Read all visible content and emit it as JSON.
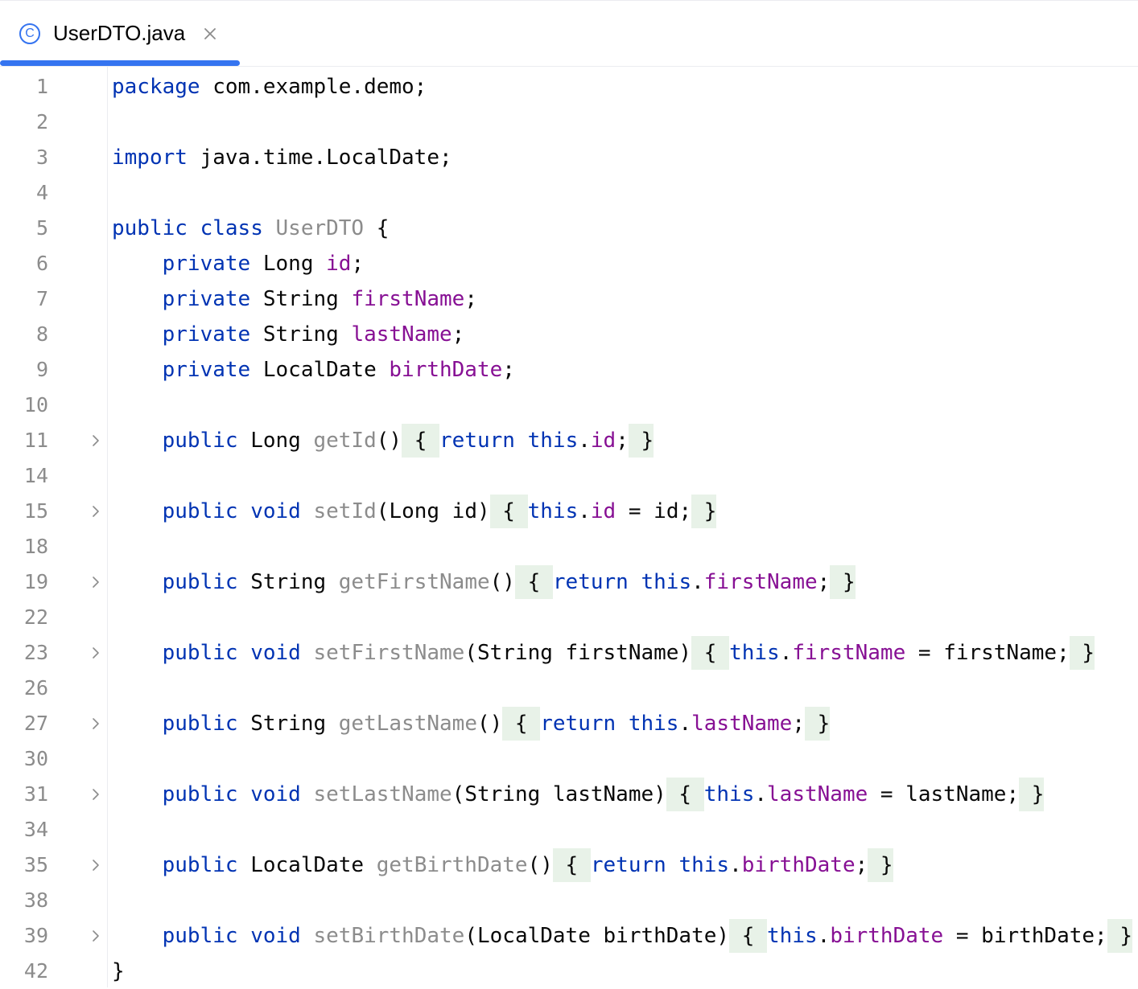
{
  "tab": {
    "icon": "class-icon",
    "icon_glyph": "C",
    "title": "UserDTO.java",
    "close_icon": "close-icon"
  },
  "colors": {
    "accent": "#3574f0",
    "keyword": "#0033b3",
    "field": "#871094",
    "line_number": "#8c8c8c",
    "text": "#080808",
    "fold_highlight": "#e8f2e8"
  },
  "lines": [
    {
      "num": "1",
      "fold": false,
      "tokens": [
        {
          "t": "package",
          "c": "kw"
        },
        {
          "t": " com.example.demo;",
          "c": ""
        }
      ]
    },
    {
      "num": "2",
      "fold": false,
      "tokens": []
    },
    {
      "num": "3",
      "fold": false,
      "tokens": [
        {
          "t": "import",
          "c": "kw"
        },
        {
          "t": " java.time.LocalDate;",
          "c": ""
        }
      ]
    },
    {
      "num": "4",
      "fold": false,
      "tokens": []
    },
    {
      "num": "5",
      "fold": false,
      "tokens": [
        {
          "t": "public",
          "c": "kw"
        },
        {
          "t": " ",
          "c": ""
        },
        {
          "t": "class",
          "c": "kw"
        },
        {
          "t": " ",
          "c": ""
        },
        {
          "t": "UserDTO",
          "c": "dim"
        },
        {
          "t": " {",
          "c": ""
        }
      ]
    },
    {
      "num": "6",
      "fold": false,
      "tokens": [
        {
          "t": "    ",
          "c": ""
        },
        {
          "t": "private",
          "c": "kw"
        },
        {
          "t": " Long ",
          "c": ""
        },
        {
          "t": "id",
          "c": "fld"
        },
        {
          "t": ";",
          "c": ""
        }
      ]
    },
    {
      "num": "7",
      "fold": false,
      "tokens": [
        {
          "t": "    ",
          "c": ""
        },
        {
          "t": "private",
          "c": "kw"
        },
        {
          "t": " String ",
          "c": ""
        },
        {
          "t": "firstName",
          "c": "fld"
        },
        {
          "t": ";",
          "c": ""
        }
      ]
    },
    {
      "num": "8",
      "fold": false,
      "tokens": [
        {
          "t": "    ",
          "c": ""
        },
        {
          "t": "private",
          "c": "kw"
        },
        {
          "t": " String ",
          "c": ""
        },
        {
          "t": "lastName",
          "c": "fld"
        },
        {
          "t": ";",
          "c": ""
        }
      ]
    },
    {
      "num": "9",
      "fold": false,
      "tokens": [
        {
          "t": "    ",
          "c": ""
        },
        {
          "t": "private",
          "c": "kw"
        },
        {
          "t": " LocalDate ",
          "c": ""
        },
        {
          "t": "birthDate",
          "c": "fld"
        },
        {
          "t": ";",
          "c": ""
        }
      ]
    },
    {
      "num": "10",
      "fold": false,
      "tokens": []
    },
    {
      "num": "11",
      "fold": true,
      "tokens": [
        {
          "t": "    ",
          "c": ""
        },
        {
          "t": "public",
          "c": "kw"
        },
        {
          "t": " Long ",
          "c": ""
        },
        {
          "t": "getId",
          "c": "dim"
        },
        {
          "t": "()",
          "c": ""
        },
        {
          "t": " { ",
          "c": "fold-bg"
        },
        {
          "t": "return",
          "c": "kw"
        },
        {
          "t": " ",
          "c": ""
        },
        {
          "t": "this",
          "c": "kw"
        },
        {
          "t": ".",
          "c": ""
        },
        {
          "t": "id",
          "c": "fld"
        },
        {
          "t": ";",
          "c": ""
        },
        {
          "t": " }",
          "c": "fold-bg"
        }
      ]
    },
    {
      "num": "14",
      "fold": false,
      "tokens": []
    },
    {
      "num": "15",
      "fold": true,
      "tokens": [
        {
          "t": "    ",
          "c": ""
        },
        {
          "t": "public",
          "c": "kw"
        },
        {
          "t": " ",
          "c": ""
        },
        {
          "t": "void",
          "c": "kw"
        },
        {
          "t": " ",
          "c": ""
        },
        {
          "t": "setId",
          "c": "dim"
        },
        {
          "t": "(Long id)",
          "c": ""
        },
        {
          "t": " { ",
          "c": "fold-bg"
        },
        {
          "t": "this",
          "c": "kw"
        },
        {
          "t": ".",
          "c": ""
        },
        {
          "t": "id",
          "c": "fld"
        },
        {
          "t": " = id;",
          "c": ""
        },
        {
          "t": " }",
          "c": "fold-bg"
        }
      ]
    },
    {
      "num": "18",
      "fold": false,
      "tokens": []
    },
    {
      "num": "19",
      "fold": true,
      "tokens": [
        {
          "t": "    ",
          "c": ""
        },
        {
          "t": "public",
          "c": "kw"
        },
        {
          "t": " String ",
          "c": ""
        },
        {
          "t": "getFirstName",
          "c": "dim"
        },
        {
          "t": "()",
          "c": ""
        },
        {
          "t": " { ",
          "c": "fold-bg"
        },
        {
          "t": "return",
          "c": "kw"
        },
        {
          "t": " ",
          "c": ""
        },
        {
          "t": "this",
          "c": "kw"
        },
        {
          "t": ".",
          "c": ""
        },
        {
          "t": "firstName",
          "c": "fld"
        },
        {
          "t": ";",
          "c": ""
        },
        {
          "t": " }",
          "c": "fold-bg"
        }
      ]
    },
    {
      "num": "22",
      "fold": false,
      "tokens": []
    },
    {
      "num": "23",
      "fold": true,
      "tokens": [
        {
          "t": "    ",
          "c": ""
        },
        {
          "t": "public",
          "c": "kw"
        },
        {
          "t": " ",
          "c": ""
        },
        {
          "t": "void",
          "c": "kw"
        },
        {
          "t": " ",
          "c": ""
        },
        {
          "t": "setFirstName",
          "c": "dim"
        },
        {
          "t": "(String firstName)",
          "c": ""
        },
        {
          "t": " { ",
          "c": "fold-bg"
        },
        {
          "t": "this",
          "c": "kw"
        },
        {
          "t": ".",
          "c": ""
        },
        {
          "t": "firstName",
          "c": "fld"
        },
        {
          "t": " = firstName;",
          "c": ""
        },
        {
          "t": " }",
          "c": "fold-bg"
        }
      ]
    },
    {
      "num": "26",
      "fold": false,
      "tokens": []
    },
    {
      "num": "27",
      "fold": true,
      "tokens": [
        {
          "t": "    ",
          "c": ""
        },
        {
          "t": "public",
          "c": "kw"
        },
        {
          "t": " String ",
          "c": ""
        },
        {
          "t": "getLastName",
          "c": "dim"
        },
        {
          "t": "()",
          "c": ""
        },
        {
          "t": " { ",
          "c": "fold-bg"
        },
        {
          "t": "return",
          "c": "kw"
        },
        {
          "t": " ",
          "c": ""
        },
        {
          "t": "this",
          "c": "kw"
        },
        {
          "t": ".",
          "c": ""
        },
        {
          "t": "lastName",
          "c": "fld"
        },
        {
          "t": ";",
          "c": ""
        },
        {
          "t": " }",
          "c": "fold-bg"
        }
      ]
    },
    {
      "num": "30",
      "fold": false,
      "tokens": []
    },
    {
      "num": "31",
      "fold": true,
      "tokens": [
        {
          "t": "    ",
          "c": ""
        },
        {
          "t": "public",
          "c": "kw"
        },
        {
          "t": " ",
          "c": ""
        },
        {
          "t": "void",
          "c": "kw"
        },
        {
          "t": " ",
          "c": ""
        },
        {
          "t": "setLastName",
          "c": "dim"
        },
        {
          "t": "(String lastName)",
          "c": ""
        },
        {
          "t": " { ",
          "c": "fold-bg"
        },
        {
          "t": "this",
          "c": "kw"
        },
        {
          "t": ".",
          "c": ""
        },
        {
          "t": "lastName",
          "c": "fld"
        },
        {
          "t": " = lastName;",
          "c": ""
        },
        {
          "t": " }",
          "c": "fold-bg"
        }
      ]
    },
    {
      "num": "34",
      "fold": false,
      "tokens": []
    },
    {
      "num": "35",
      "fold": true,
      "tokens": [
        {
          "t": "    ",
          "c": ""
        },
        {
          "t": "public",
          "c": "kw"
        },
        {
          "t": " LocalDate ",
          "c": ""
        },
        {
          "t": "getBirthDate",
          "c": "dim"
        },
        {
          "t": "()",
          "c": ""
        },
        {
          "t": " { ",
          "c": "fold-bg"
        },
        {
          "t": "return",
          "c": "kw"
        },
        {
          "t": " ",
          "c": ""
        },
        {
          "t": "this",
          "c": "kw"
        },
        {
          "t": ".",
          "c": ""
        },
        {
          "t": "birthDate",
          "c": "fld"
        },
        {
          "t": ";",
          "c": ""
        },
        {
          "t": " }",
          "c": "fold-bg"
        }
      ]
    },
    {
      "num": "38",
      "fold": false,
      "tokens": []
    },
    {
      "num": "39",
      "fold": true,
      "tokens": [
        {
          "t": "    ",
          "c": ""
        },
        {
          "t": "public",
          "c": "kw"
        },
        {
          "t": " ",
          "c": ""
        },
        {
          "t": "void",
          "c": "kw"
        },
        {
          "t": " ",
          "c": ""
        },
        {
          "t": "setBirthDate",
          "c": "dim"
        },
        {
          "t": "(LocalDate birthDate)",
          "c": ""
        },
        {
          "t": " { ",
          "c": "fold-bg"
        },
        {
          "t": "this",
          "c": "kw"
        },
        {
          "t": ".",
          "c": ""
        },
        {
          "t": "birthDate",
          "c": "fld"
        },
        {
          "t": " = birthDate;",
          "c": ""
        },
        {
          "t": " }",
          "c": "fold-bg"
        }
      ]
    },
    {
      "num": "42",
      "fold": false,
      "tokens": [
        {
          "t": "}",
          "c": ""
        }
      ]
    }
  ]
}
